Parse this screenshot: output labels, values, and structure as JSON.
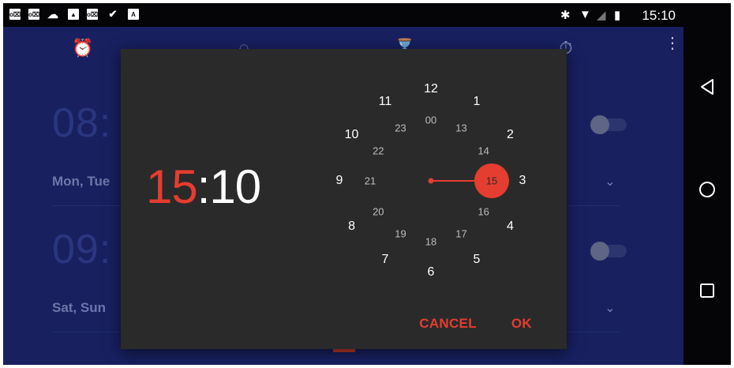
{
  "status_bar": {
    "left_icons": [
      {
        "name": "outlook-icon",
        "glyph": "o⌧"
      },
      {
        "name": "outlook-icon",
        "glyph": "o⌧"
      },
      {
        "name": "cloud-sync-icon",
        "glyph": "☁"
      },
      {
        "name": "image-icon",
        "glyph": "▲"
      },
      {
        "name": "outlook-icon",
        "glyph": "o⌧"
      },
      {
        "name": "check-mail-icon",
        "glyph": "✔"
      },
      {
        "name": "translate-a-icon",
        "glyph": "A"
      }
    ],
    "time": "15:10"
  },
  "background": {
    "alarms": [
      {
        "time": "08:",
        "days": "Mon, Tue"
      },
      {
        "time": "09:",
        "days": "Sat, Sun"
      }
    ]
  },
  "dialog": {
    "hour": "15",
    "separator": ":",
    "minute": "10",
    "clock": {
      "outer": [
        "12",
        "1",
        "2",
        "3",
        "4",
        "5",
        "6",
        "7",
        "8",
        "9",
        "10",
        "11"
      ],
      "inner": [
        "00",
        "13",
        "14",
        "15",
        "16",
        "17",
        "18",
        "19",
        "20",
        "21",
        "22",
        "23"
      ],
      "selected": "15"
    },
    "cancel_label": "CANCEL",
    "ok_label": "OK"
  },
  "colors": {
    "accent": "#e53d2f",
    "dialog_bg": "#2a2a2a",
    "app_bg": "#182060"
  }
}
